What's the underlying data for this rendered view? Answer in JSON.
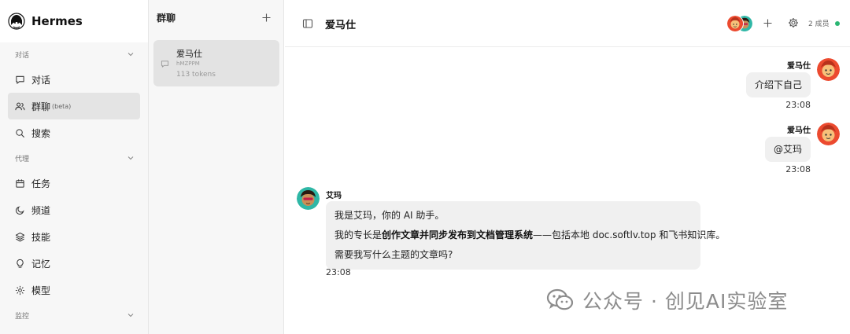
{
  "app": {
    "name": "Hermes"
  },
  "sidebar": {
    "sections": [
      {
        "label": "对话",
        "items": [
          {
            "label": "对话",
            "icon": "chat-icon"
          },
          {
            "label": "群聊",
            "badge": "(beta)",
            "icon": "group-icon",
            "active": true
          },
          {
            "label": "搜索",
            "icon": "search-icon"
          }
        ]
      },
      {
        "label": "代理",
        "items": [
          {
            "label": "任务",
            "icon": "calendar-icon"
          },
          {
            "label": "频道",
            "icon": "moon-icon"
          },
          {
            "label": "技能",
            "icon": "layers-icon"
          },
          {
            "label": "记忆",
            "icon": "lightbulb-icon"
          },
          {
            "label": "模型",
            "icon": "sparkle-icon"
          }
        ]
      },
      {
        "label": "监控",
        "items": []
      }
    ]
  },
  "conversations": {
    "title": "群聊",
    "items": [
      {
        "name": "爱马仕",
        "id": "hMZPPM",
        "tokens": "113 tokens"
      }
    ]
  },
  "chat": {
    "title": "爱马仕",
    "members": "2 成员",
    "colors": {
      "online": "#2bb673",
      "bubble": "#f0f0f0"
    },
    "messages": [
      {
        "sender": "爱马仕",
        "role": "user",
        "text": "介绍下自己",
        "time": "23:08"
      },
      {
        "sender": "爱马仕",
        "role": "user",
        "text": "@艾玛",
        "time": "23:08"
      },
      {
        "sender": "艾玛",
        "role": "assistant",
        "time": "23:08",
        "line1": "我是艾玛，你的 AI 助手。",
        "line2_pre": "我的专长是",
        "line2_bold": "创作文章并同步发布到文档管理系统",
        "line2_post": "——包括本地 doc.softlv.top 和飞书知识库。",
        "line3": "需要我写什么主题的文章吗?"
      }
    ]
  },
  "watermark": {
    "text": "公众号 · 创见AI实验室"
  }
}
